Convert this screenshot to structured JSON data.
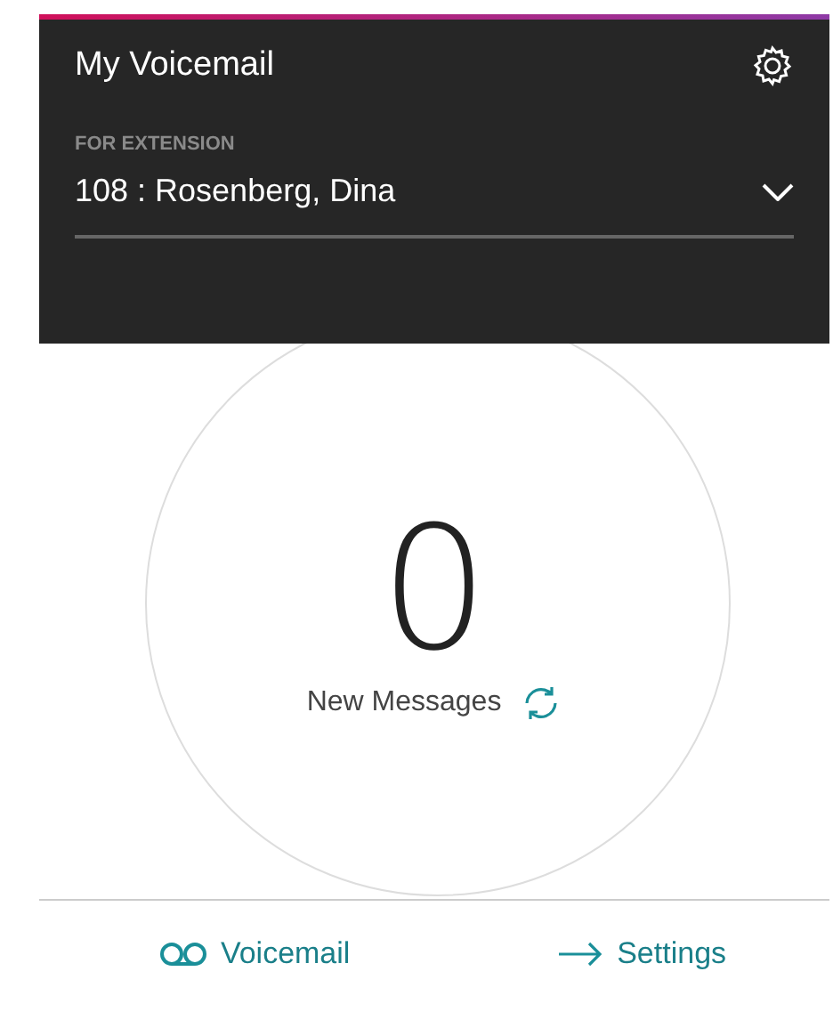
{
  "header": {
    "title": "My Voicemail",
    "extension_label": "FOR EXTENSION",
    "extension_value": "108 : Rosenberg, Dina"
  },
  "summary": {
    "count": "0",
    "label": "New Messages"
  },
  "footer_links": [
    {
      "kind": "voicemail",
      "label": "Voicemail"
    },
    {
      "kind": "arrow",
      "label": "Settings"
    }
  ]
}
